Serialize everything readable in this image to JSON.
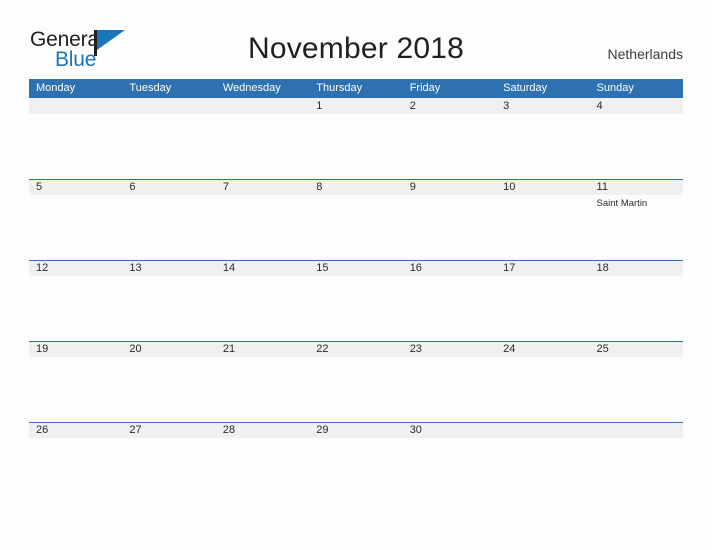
{
  "brand": {
    "name_part1": "General",
    "name_part2": "Blue",
    "flag_icon": "blue-flag-icon",
    "color_dark": "#231f20",
    "color_blue": "#1b75bb"
  },
  "header": {
    "title": "November 2018",
    "country": "Netherlands",
    "accent_color": "#2d71b0",
    "band_color": "#f0f0f0"
  },
  "weekdays": [
    "Monday",
    "Tuesday",
    "Wednesday",
    "Thursday",
    "Friday",
    "Saturday",
    "Sunday"
  ],
  "weeks": [
    [
      {
        "num": "",
        "event": ""
      },
      {
        "num": "",
        "event": ""
      },
      {
        "num": "",
        "event": ""
      },
      {
        "num": "1",
        "event": ""
      },
      {
        "num": "2",
        "event": ""
      },
      {
        "num": "3",
        "event": ""
      },
      {
        "num": "4",
        "event": ""
      }
    ],
    [
      {
        "num": "5",
        "event": ""
      },
      {
        "num": "6",
        "event": ""
      },
      {
        "num": "7",
        "event": ""
      },
      {
        "num": "8",
        "event": ""
      },
      {
        "num": "9",
        "event": ""
      },
      {
        "num": "10",
        "event": ""
      },
      {
        "num": "11",
        "event": "Saint Martin"
      }
    ],
    [
      {
        "num": "12",
        "event": ""
      },
      {
        "num": "13",
        "event": ""
      },
      {
        "num": "14",
        "event": ""
      },
      {
        "num": "15",
        "event": ""
      },
      {
        "num": "16",
        "event": ""
      },
      {
        "num": "17",
        "event": ""
      },
      {
        "num": "18",
        "event": ""
      }
    ],
    [
      {
        "num": "19",
        "event": ""
      },
      {
        "num": "20",
        "event": ""
      },
      {
        "num": "21",
        "event": ""
      },
      {
        "num": "22",
        "event": ""
      },
      {
        "num": "23",
        "event": ""
      },
      {
        "num": "24",
        "event": ""
      },
      {
        "num": "25",
        "event": ""
      }
    ],
    [
      {
        "num": "26",
        "event": ""
      },
      {
        "num": "27",
        "event": ""
      },
      {
        "num": "28",
        "event": ""
      },
      {
        "num": "29",
        "event": ""
      },
      {
        "num": "30",
        "event": ""
      },
      {
        "num": "",
        "event": ""
      },
      {
        "num": "",
        "event": ""
      }
    ]
  ]
}
